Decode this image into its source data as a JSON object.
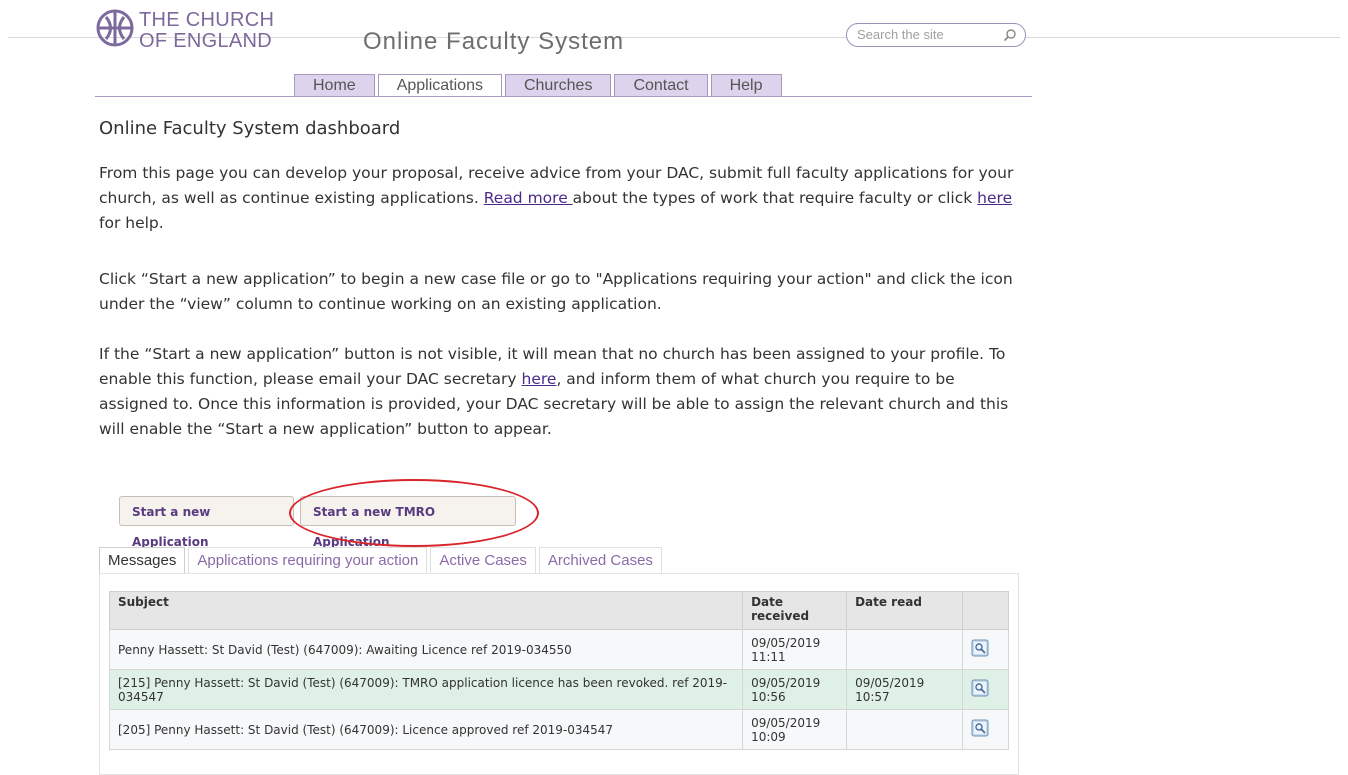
{
  "header": {
    "logo_line1": "THE CHURCH",
    "logo_line2": "OF ENGLAND",
    "site_title": "Online Faculty System",
    "search_placeholder": "Search the site",
    "nav": [
      "Home",
      "Applications",
      "Churches",
      "Contact",
      "Help"
    ],
    "active_nav": "Applications",
    "colors": {
      "brand": "#7d6a9c",
      "nav_tab_bg": "#ddd3ec",
      "link": "#4b2a8a"
    }
  },
  "main": {
    "heading": "Online Faculty System dashboard",
    "p1_a": "From this page you can develop your proposal, receive advice from your DAC, submit full faculty applications for your church, as well as continue existing applications. ",
    "p1_link1": "Read more ",
    "p1_b": "about the types of work that require faculty or click ",
    "p1_link2": "here",
    "p1_c": " for help.",
    "p2": "Click “Start a new application” to begin a new case file or go to \"Applications requiring your action\" and click the icon under the “view” column to continue working on an existing application.",
    "p3_a": "If the “Start a new application” button is not visible, it will mean that no church has been assigned to your profile. To enable this function, please email your DAC secretary ",
    "p3_link": "here",
    "p3_b": ", and inform them of what church you require to be assigned to. Once this information is provided, your DAC secretary will be able to assign the relevant church and this will enable the “Start a new application” button to appear."
  },
  "buttons": {
    "start_new": "Start a new Application",
    "start_tmro": "Start a new TMRO Application",
    "highlight_color": "#d8262c"
  },
  "tabs": [
    "Messages",
    "Applications requiring your action",
    "Active Cases",
    "Archived Cases"
  ],
  "active_tab": "Messages",
  "table": {
    "headers": [
      "Subject",
      "Date received",
      "Date read",
      ""
    ],
    "rows": [
      {
        "subject": "Penny Hassett: St David (Test) (647009): Awaiting Licence ref 2019-034550",
        "received": "09/05/2019 11:11",
        "read": ""
      },
      {
        "subject": "[215] Penny Hassett: St David (Test) (647009): TMRO application licence has been revoked. ref 2019-034547",
        "received": "09/05/2019 10:56",
        "read": "09/05/2019 10:57"
      },
      {
        "subject": "[205] Penny Hassett: St David (Test) (647009): Licence approved ref 2019-034547",
        "received": "09/05/2019 10:09",
        "read": ""
      }
    ]
  }
}
